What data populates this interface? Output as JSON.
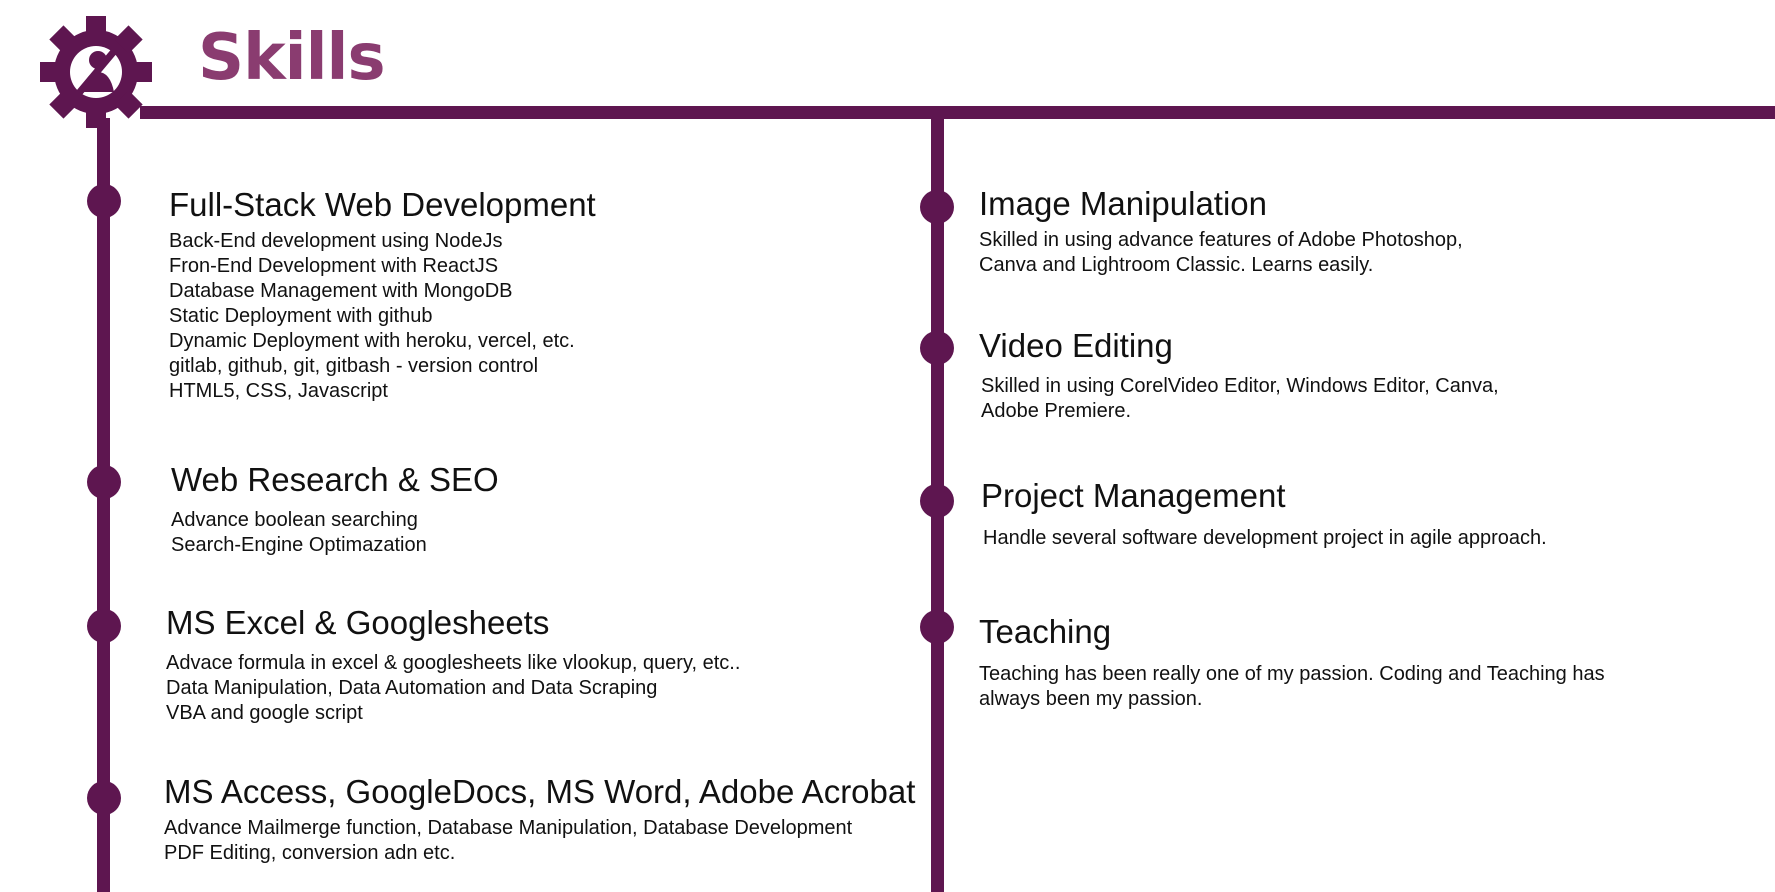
{
  "page": {
    "title": "Skills",
    "icon": "gear-person-icon"
  },
  "colors": {
    "accent": "#5e1650",
    "title": "#8a3c70"
  },
  "left_column": [
    {
      "title": "Full-Stack Web Development",
      "lines": [
        "Back-End development using NodeJs",
        "Fron-End Development with ReactJS",
        "Database Management with MongoDB",
        "Static Deployment with github",
        "Dynamic Deployment with heroku, vercel, etc.",
        "gitlab, github, git, gitbash - version control",
        "HTML5, CSS, Javascript"
      ]
    },
    {
      "title": "Web Research & SEO",
      "lines": [
        "Advance boolean searching",
        "Search-Engine Optimazation"
      ]
    },
    {
      "title": "MS Excel & Googlesheets",
      "lines": [
        "Advace formula in excel & googlesheets like vlookup, query, etc..",
        "Data Manipulation, Data Automation and Data Scraping",
        "VBA and google script"
      ]
    },
    {
      "title": "MS Access, GoogleDocs, MS Word, Adobe Acrobat",
      "lines": [
        "Advance Mailmerge function, Database Manipulation, Database Development",
        "PDF Editing, conversion adn etc."
      ]
    }
  ],
  "right_column": [
    {
      "title": "Image Manipulation",
      "lines": [
        "Skilled in using advance features of Adobe Photoshop,",
        "Canva and Lightroom Classic. Learns easily."
      ]
    },
    {
      "title": "Video Editing",
      "lines": [
        "Skilled in using CorelVideo Editor, Windows Editor, Canva,",
        "Adobe Premiere."
      ]
    },
    {
      "title": "Project Management",
      "lines": [
        "Handle several software development project in agile approach."
      ]
    },
    {
      "title": "Teaching",
      "lines": [
        "Teaching has been really one of my passion. Coding and Teaching has",
        "always been my passion."
      ]
    }
  ]
}
